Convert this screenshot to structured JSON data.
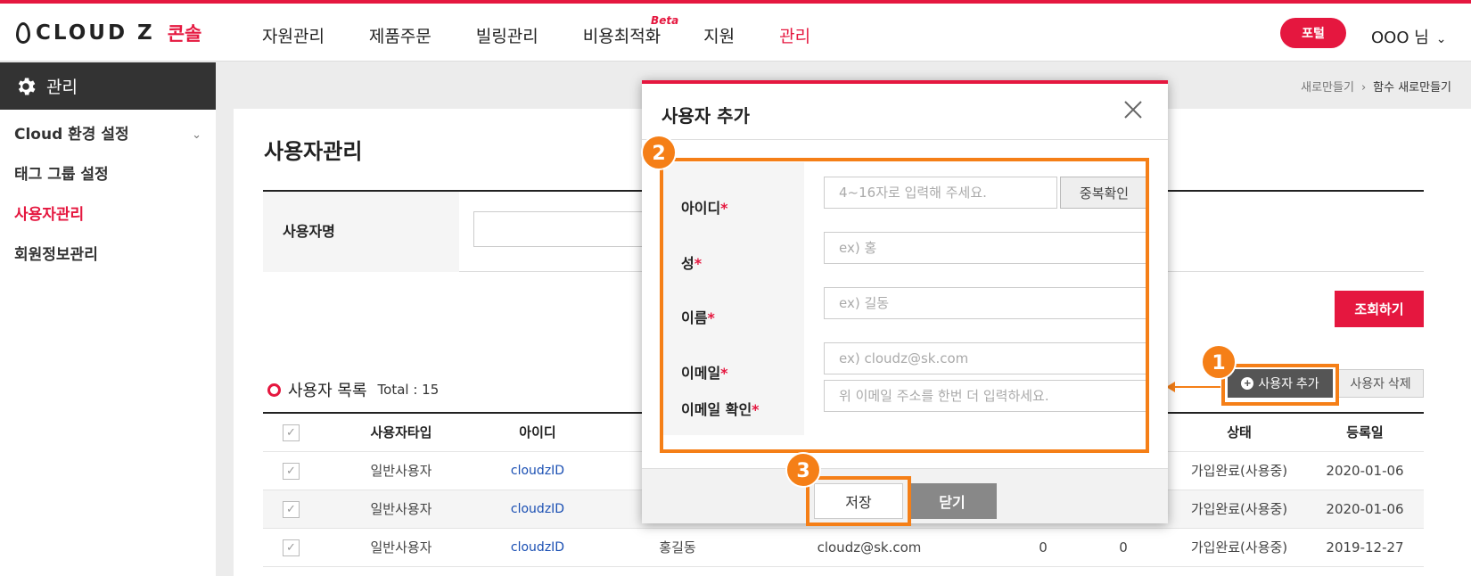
{
  "header": {
    "logo_text": "CLOUD Z",
    "logo_sub": "콘솔",
    "nav": [
      "자원관리",
      "제품주문",
      "빌링관리",
      "비용최적화",
      "지원",
      "관리"
    ],
    "beta_label": "Beta",
    "portal_label": "포털",
    "user_label": "OOO 님"
  },
  "sidebar": {
    "title": "관리",
    "items": [
      "Cloud 환경 설정",
      "태그 그룹 설정",
      "사용자관리",
      "회원정보관리"
    ]
  },
  "breadcrumb": {
    "parent": "새로만들기",
    "current": "함수 새로만들기"
  },
  "page": {
    "title": "사용자관리",
    "search_label": "사용자명",
    "search_button": "조회하기",
    "list_title": "사용자 목록",
    "total": "Total : 15",
    "add_button": "사용자 추가",
    "delete_button": "사용자 삭제"
  },
  "table": {
    "headers": {
      "type": "사용자타입",
      "id": "아이디",
      "status": "상태",
      "date": "등록일"
    },
    "rows": [
      {
        "type": "일반사용자",
        "id": "cloudzID",
        "name": "",
        "email": "",
        "c1": "",
        "c2": "",
        "status": "가입완료(사용중)",
        "date": "2020-01-06"
      },
      {
        "type": "일반사용자",
        "id": "cloudzID",
        "name": "",
        "email": "",
        "c1": "",
        "c2": "",
        "status": "가입완료(사용중)",
        "date": "2020-01-06"
      },
      {
        "type": "일반사용자",
        "id": "cloudzID",
        "name": "홍길동",
        "email": "cloudz@sk.com",
        "c1": "0",
        "c2": "0",
        "status": "가입완료(사용중)",
        "date": "2019-12-27"
      }
    ]
  },
  "dialog": {
    "title": "사용자 추가",
    "fields": {
      "id_label": "아이디",
      "id_placeholder": "4~16자로 입력해 주세요.",
      "dup_check": "중복확인",
      "last_label": "성",
      "last_placeholder": "ex) 홍",
      "first_label": "이름",
      "first_placeholder": "ex) 길동",
      "email_label": "이메일",
      "email_placeholder": "ex) cloudz@sk.com",
      "email_confirm_label": "이메일 확인",
      "email_confirm_placeholder": "위 이메일 주소를 한번 더 입력하세요."
    },
    "required_mark": "*",
    "save_button": "저장",
    "close_button": "닫기"
  },
  "steps": [
    "1",
    "2",
    "3"
  ],
  "colors": {
    "accent": "#e5173f",
    "highlight": "#f57f17"
  }
}
